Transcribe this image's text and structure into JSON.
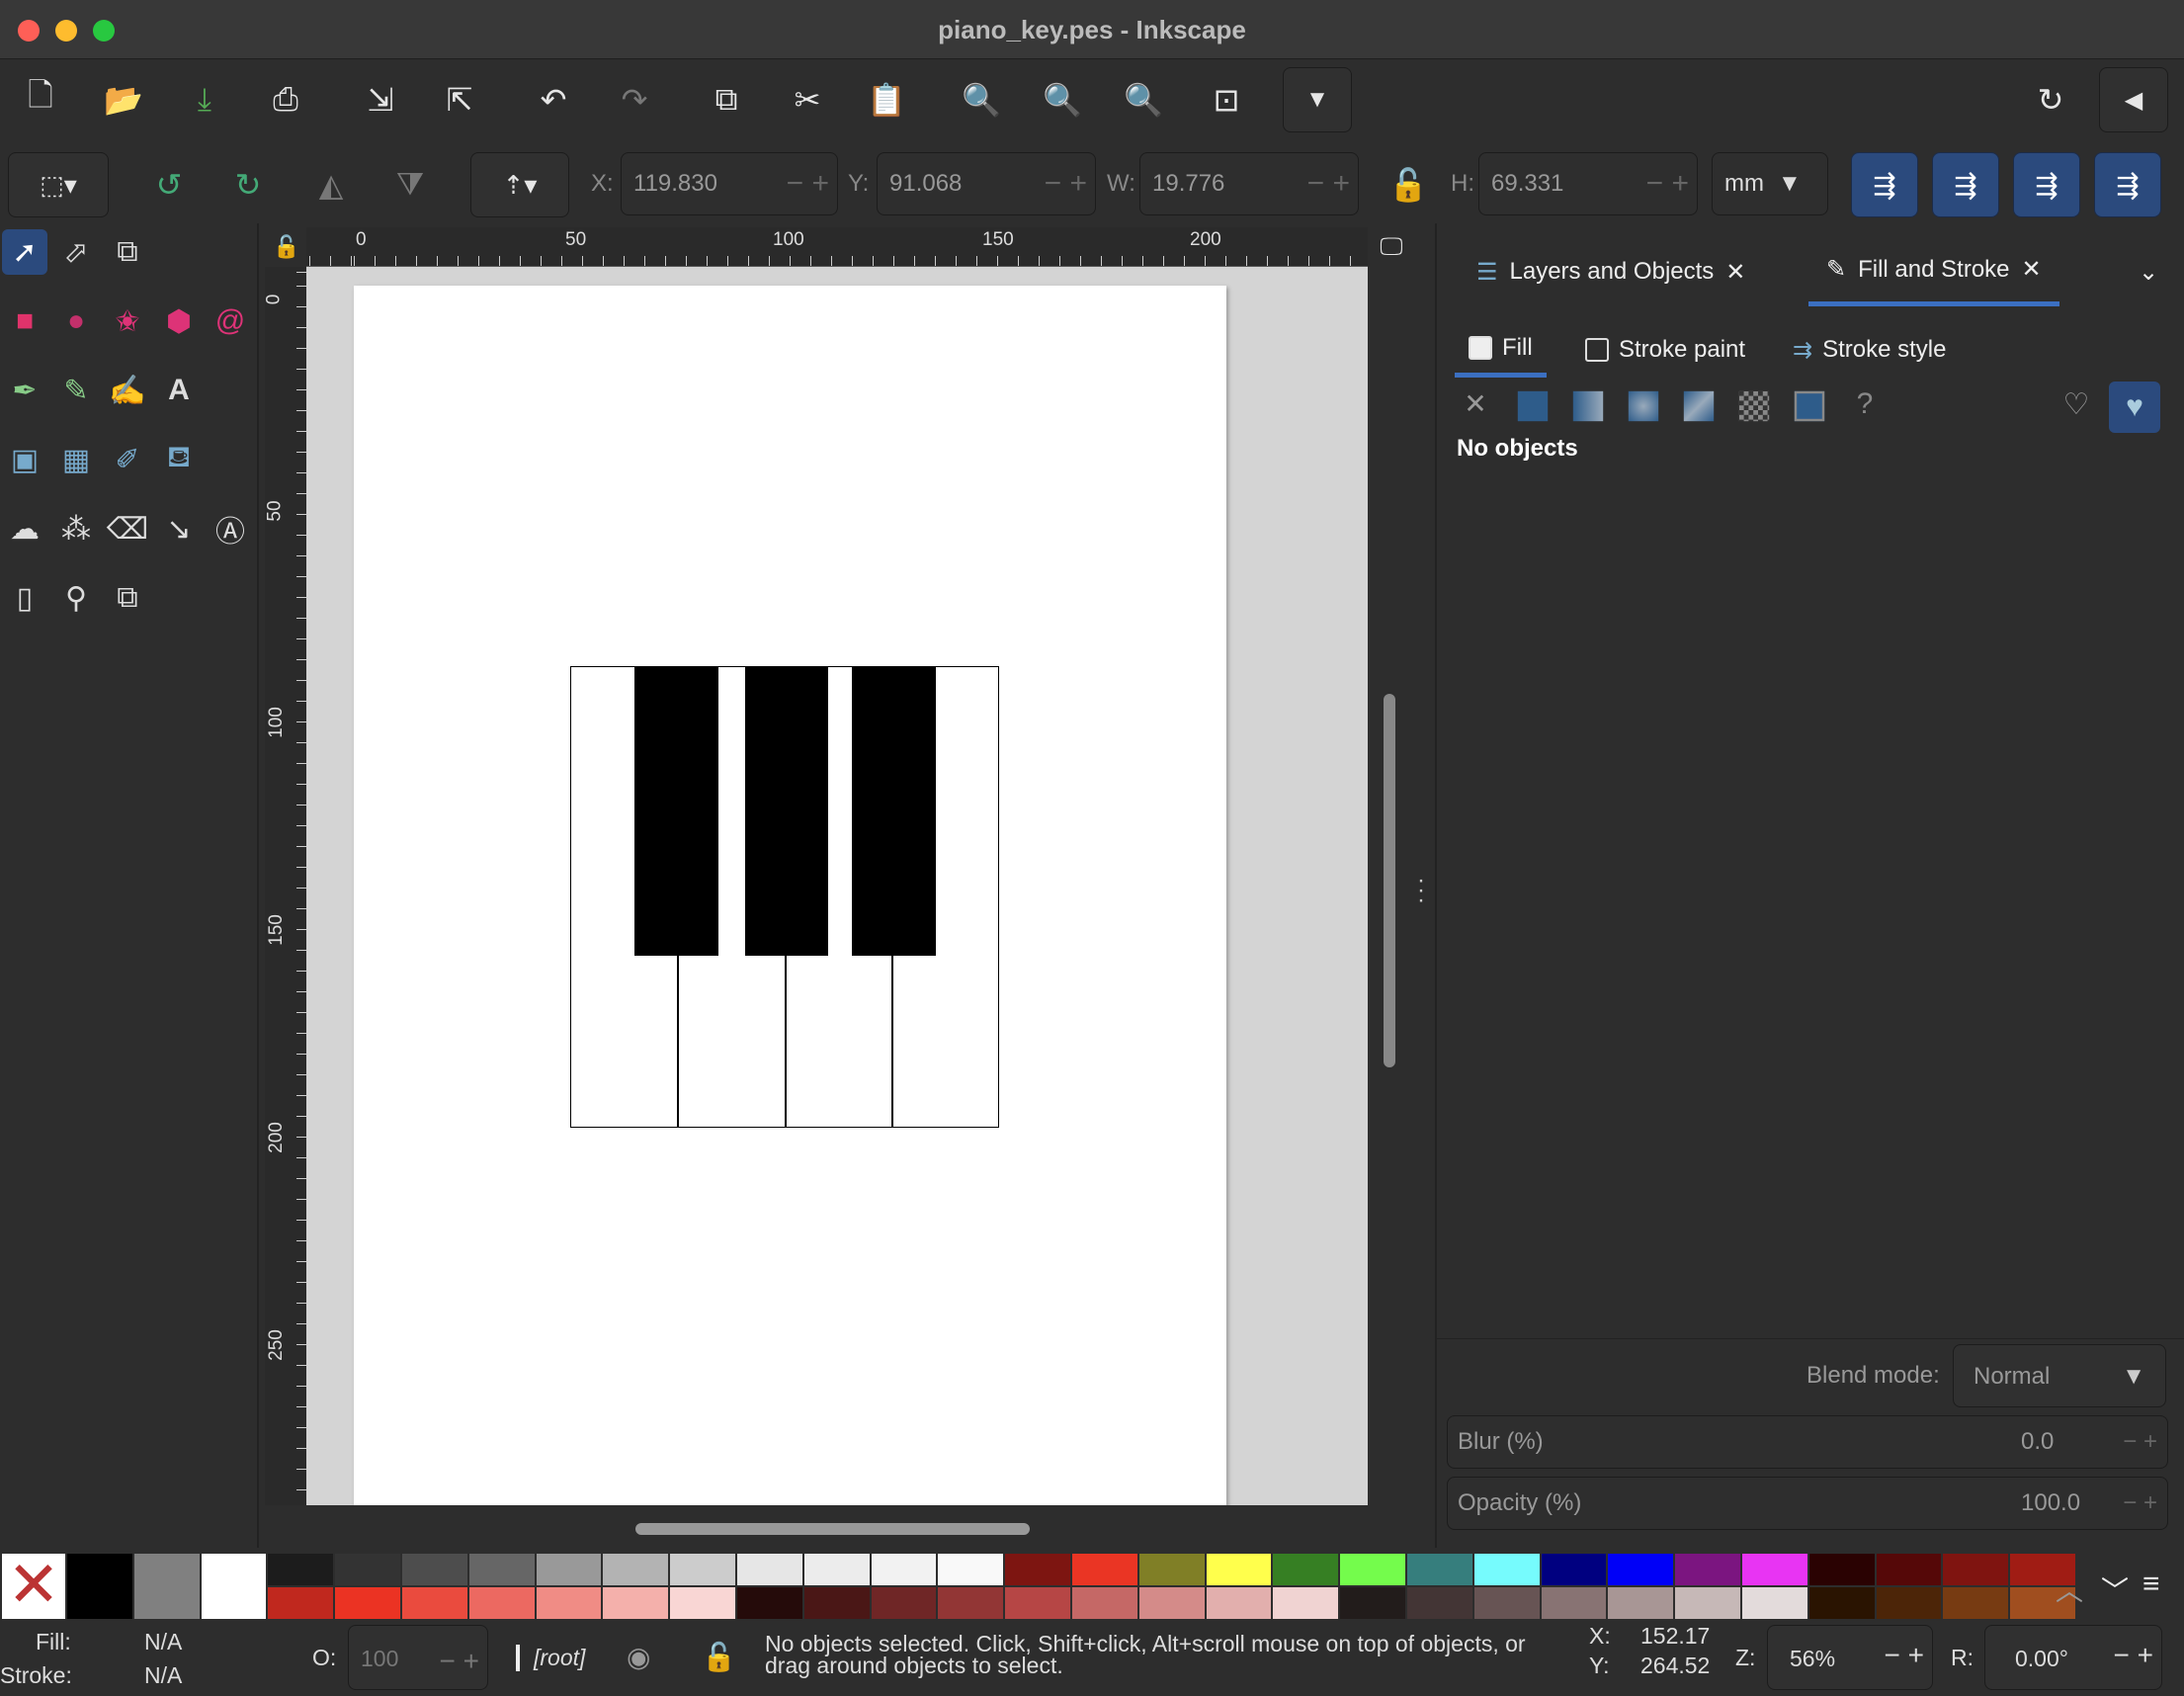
{
  "window": {
    "title": "piano_key.pes - Inkscape"
  },
  "toolbar": {
    "icons": [
      "new-document-icon",
      "open-icon",
      "save-icon",
      "print-icon",
      "import-icon",
      "export-icon",
      "undo-icon",
      "redo-icon",
      "duplicate-icon",
      "cut-icon",
      "paste-icon",
      "zoom-selection-icon",
      "zoom-drawing-icon",
      "zoom-page-icon",
      "zoom-center-icon",
      "more-dropdown-icon"
    ]
  },
  "selectbar": {
    "x_label": "X:",
    "x": "119.830",
    "y_label": "Y:",
    "y": "91.068",
    "w_label": "W:",
    "w": "19.776",
    "h_label": "H:",
    "h": "69.331",
    "unit": "mm"
  },
  "ruler": {
    "top": [
      "0",
      "50",
      "100",
      "150",
      "200"
    ],
    "left": [
      "0",
      "50",
      "100",
      "150",
      "200",
      "250"
    ]
  },
  "panel": {
    "tabs": [
      {
        "label": "Layers and Objects"
      },
      {
        "label": "Fill and Stroke"
      }
    ],
    "subtabs": [
      "Fill",
      "Stroke paint",
      "Stroke style"
    ],
    "message": "No objects",
    "blend_label": "Blend mode:",
    "blend_value": "Normal",
    "blur_label": "Blur (%)",
    "blur_value": "0.0",
    "opacity_label": "Opacity (%)",
    "opacity_value": "100.0"
  },
  "palette": {
    "fixed": [
      "#000000",
      "#808080",
      "#ffffff"
    ],
    "top": [
      "#1c1c1c",
      "#333333",
      "#4d4d4d",
      "#666666",
      "#999999",
      "#b3b3b3",
      "#cccccc",
      "#e6e6e6",
      "#ececec",
      "#f2f2f2",
      "#f9f9f9",
      "#7d1511",
      "#ea3524",
      "#807f26",
      "#ffff4c",
      "#367f23",
      "#74fc4c",
      "#367e7d",
      "#76fbfd",
      "#000080",
      "#0000f7",
      "#7b1580",
      "#e834f3",
      "#2a0202",
      "#550808",
      "#7f1410",
      "#a01c14"
    ],
    "bottom": [
      "#c0281e",
      "#eb3323",
      "#ea4b3e",
      "#ec6961",
      "#f08c85",
      "#f4b0ab",
      "#f9d6d4",
      "#250b0a",
      "#4a1716",
      "#6f2626",
      "#923635",
      "#b64645",
      "#c56866",
      "#d48b89",
      "#e2afad",
      "#f0d3d2",
      "#221c1b",
      "#433535",
      "#675454",
      "#887373",
      "#a89695",
      "#c6b8b7",
      "#e3dbdb",
      "#2a1401",
      "#4c2508",
      "#773b12",
      "#a04e1f"
    ]
  },
  "status": {
    "fill_label": "Fill:",
    "fill": "N/A",
    "stroke_label": "Stroke:",
    "stroke": "N/A",
    "opacity_label": "O:",
    "opacity": "100",
    "layer": "[root]",
    "message": "No objects selected. Click, Shift+click, Alt+scroll mouse on top of objects, or drag around objects to select.",
    "x_label": "X:",
    "x": "152.17",
    "y_label": "Y:",
    "y": "264.52",
    "zoom_label": "Z:",
    "zoom": "56%",
    "rotate_label": "R:",
    "rotate": "0.00°"
  }
}
